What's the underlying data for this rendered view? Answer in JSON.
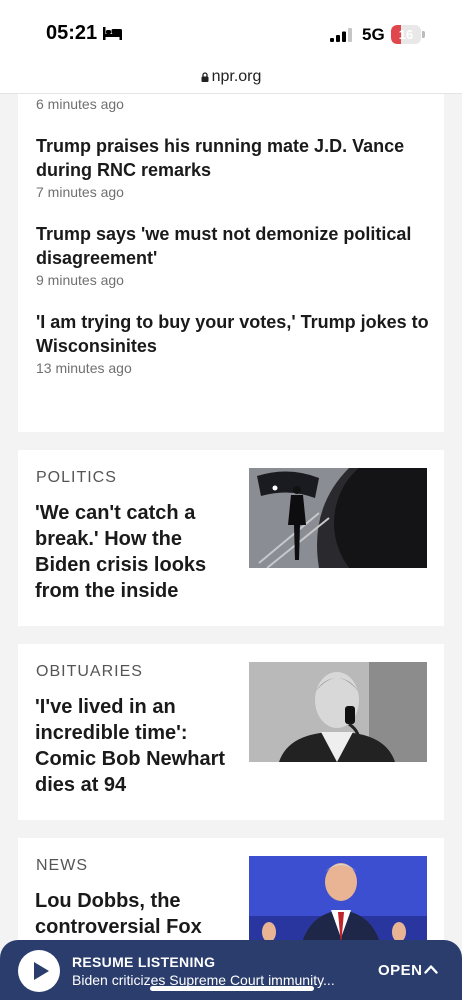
{
  "status_bar": {
    "time": "05:21",
    "network": "5G",
    "battery": "16",
    "battery_level": 0.16,
    "icons": [
      "bed-icon",
      "signal-icon",
      "battery-icon"
    ]
  },
  "browser": {
    "url": "npr.org",
    "icons": [
      "lock-icon"
    ]
  },
  "live_updates": [
    {
      "title": "",
      "time": "6 minutes ago"
    },
    {
      "title": "Trump praises his running mate J.D. Vance during RNC remarks",
      "time": "7 minutes ago"
    },
    {
      "title": "Trump says 'we must not demonize political disagreement'",
      "time": "9 minutes ago"
    },
    {
      "title": "'I am trying to buy your votes,' Trump jokes to Wisconsinites",
      "time": "13 minutes ago"
    }
  ],
  "stories": [
    {
      "section": "POLITICS",
      "title": "'We can't catch a break.' How the Biden crisis looks from the inside"
    },
    {
      "section": "OBITUARIES",
      "title": "'I've lived in an incredible time': Comic Bob Newhart dies at 94"
    },
    {
      "section": "NEWS",
      "title": "Lou Dobbs, the controversial Fox"
    }
  ],
  "player": {
    "heading": "RESUME LISTENING",
    "subtitle": "Biden criticizes Supreme Court immunity...",
    "open_label": "OPEN",
    "icons": [
      "play-icon",
      "chevron-up-icon"
    ]
  },
  "colors": {
    "player_bg": "#2b3d6d",
    "battery_low": "#e0474c",
    "page_bg": "#f3f3f3"
  }
}
